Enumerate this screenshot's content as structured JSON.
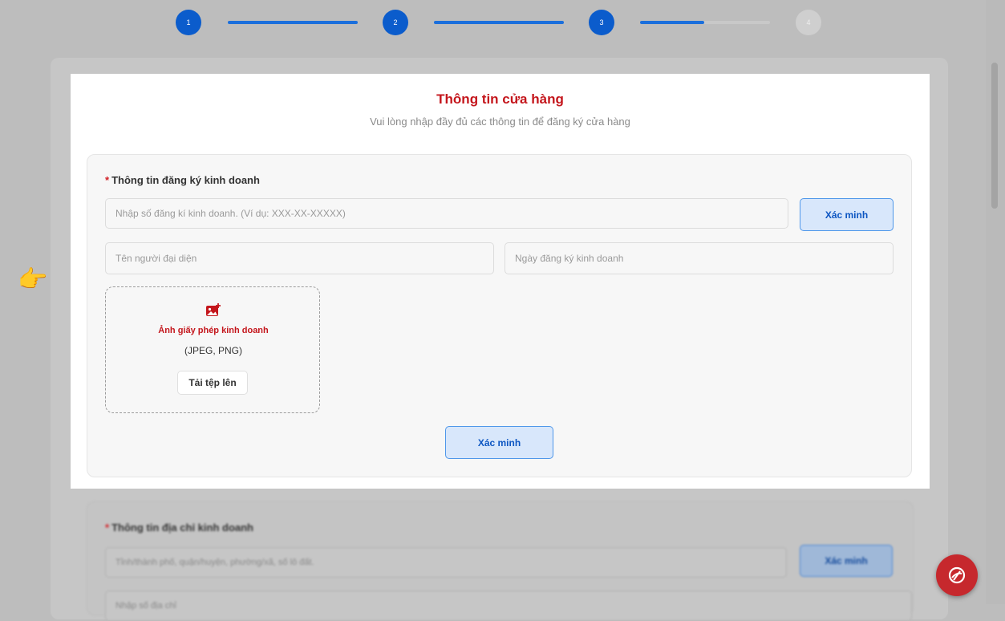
{
  "stepper": {
    "steps": [
      {
        "label": "1",
        "state": "done"
      },
      {
        "label": "2",
        "state": "done"
      },
      {
        "label": "3",
        "state": "current"
      },
      {
        "label": "4",
        "state": "pending"
      }
    ],
    "accent": "#0b5ccc"
  },
  "header": {
    "title": "Thông tin cửa hàng",
    "subtitle": "Vui lòng nhập đầy đủ các thông tin để đăng ký cửa hàng"
  },
  "business_registration": {
    "required_mark": "*",
    "label": "Thông tin đăng ký kinh doanh",
    "registration_number_placeholder": "Nhập số đăng kí kinh doanh. (Ví dụ: XXX-XX-XXXXX)",
    "verify_label": "Xác minh",
    "representative_placeholder": "Tên người đại diện",
    "registration_date_placeholder": "Ngày đăng ký kinh doanh",
    "upload": {
      "icon": "image-add-icon",
      "title": "Ảnh giấy phép kinh doanh",
      "formats": "(JPEG, PNG)",
      "button_label": "Tải tệp lên"
    },
    "submit_label": "Xác minh"
  },
  "business_address": {
    "required_mark": "*",
    "label": "Thông tin địa chỉ kinh doanh",
    "address_placeholder": "Tỉnh/thành phố, quận/huyện, phường/xã, số lô đất.",
    "verify_label": "Xác minh",
    "detail_placeholder": "Nhập số địa chỉ"
  },
  "pointer": {
    "icon": "pointing-hand-icon",
    "glyph": "👉"
  },
  "chat_button": {
    "icon": "chat-icon",
    "color": "#c6282d"
  }
}
